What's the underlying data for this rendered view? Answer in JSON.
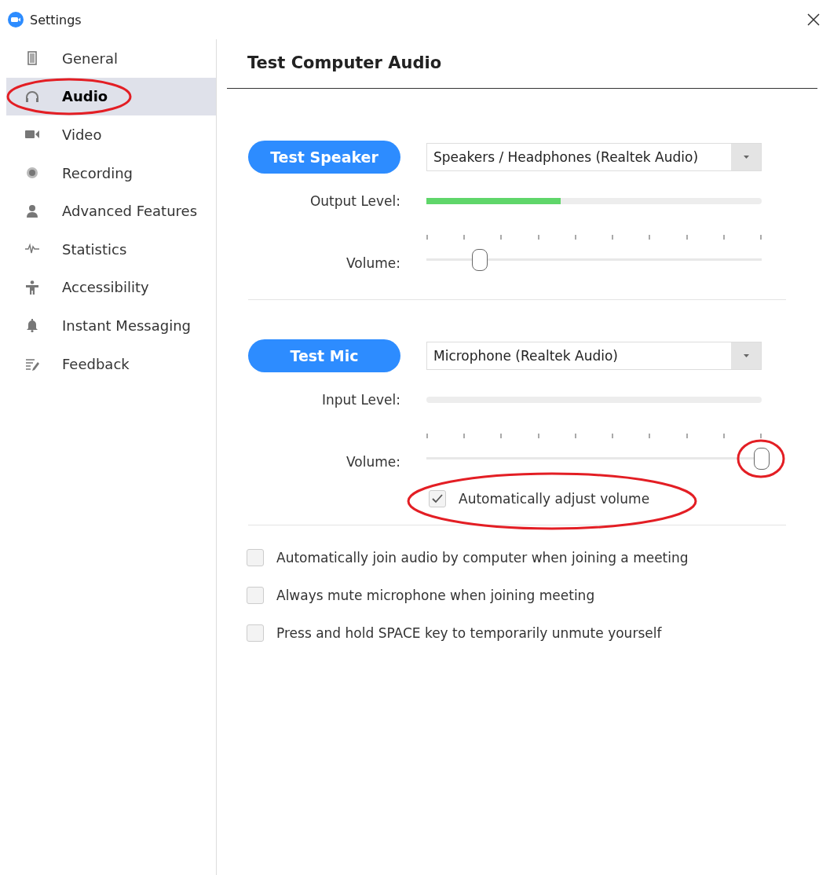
{
  "window": {
    "title": "Settings"
  },
  "sidebar": {
    "items": [
      {
        "label": "General",
        "selected": false,
        "circled": false
      },
      {
        "label": "Audio",
        "selected": true,
        "circled": true
      },
      {
        "label": "Video",
        "selected": false,
        "circled": false
      },
      {
        "label": "Recording",
        "selected": false,
        "circled": false
      },
      {
        "label": "Advanced Features",
        "selected": false,
        "circled": false
      },
      {
        "label": "Statistics",
        "selected": false,
        "circled": false
      },
      {
        "label": "Accessibility",
        "selected": false,
        "circled": false
      },
      {
        "label": "Instant Messaging",
        "selected": false,
        "circled": false
      },
      {
        "label": "Feedback",
        "selected": false,
        "circled": false
      }
    ]
  },
  "content": {
    "title": "Test Computer Audio",
    "sections": [
      {
        "button": "Test Speaker",
        "device": "Speakers / Headphones (Realtek Audio)",
        "level_label": "Output Level:",
        "level": 0.4,
        "volume_label": "Volume:",
        "volume": {
          "level": 0.16,
          "circled": false
        }
      },
      {
        "button": "Test Mic",
        "device": "Microphone (Realtek Audio)",
        "level_label": "Input Level:",
        "level": 0,
        "volume_label": "Volume:",
        "volume": {
          "level": 1,
          "circled": true
        },
        "auto_adjust": {
          "label": "Automatically adjust volume",
          "checked": true,
          "circled": true
        }
      }
    ],
    "options": [
      {
        "label": "Automatically join audio by computer when joining a meeting",
        "checked": false
      },
      {
        "label": "Always mute microphone when joining meeting",
        "checked": false
      },
      {
        "label": "Press and hold SPACE key to temporarily unmute yourself",
        "checked": false
      }
    ]
  }
}
